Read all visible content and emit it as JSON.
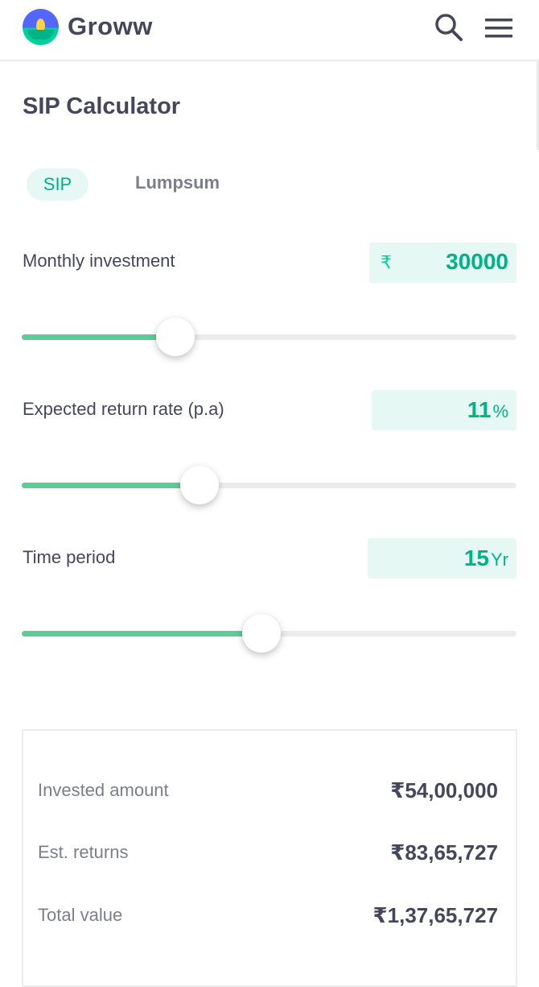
{
  "header": {
    "brand": "Groww",
    "icons": [
      "groww-logo-icon",
      "search-icon",
      "menu-icon"
    ]
  },
  "page": {
    "title": "SIP Calculator"
  },
  "tabs": [
    {
      "label": "SIP",
      "active": true
    },
    {
      "label": "Lumpsum",
      "active": false
    }
  ],
  "monthly_investment": {
    "label": "Monthly investment",
    "currency": "₹",
    "value": "30000",
    "slider_fraction": 0.31
  },
  "return_rate": {
    "label": "Expected return rate (p.a)",
    "value": "11",
    "unit": "%",
    "slider_fraction": 0.36
  },
  "time_period": {
    "label": "Time period",
    "value": "15",
    "unit": "Yr",
    "slider_fraction": 0.485
  },
  "results": [
    {
      "label": "Invested amount",
      "value": "₹54,00,000"
    },
    {
      "label": "Est. returns",
      "value": "₹83,65,727"
    },
    {
      "label": "Total value",
      "value": "₹1,37,65,727"
    }
  ],
  "colors": {
    "accent": "#00b386",
    "accent_bg": "#e6f8f3",
    "slider_fill": "#5ecb97",
    "text_primary": "#44475b",
    "text_secondary": "#7c7e8c"
  }
}
